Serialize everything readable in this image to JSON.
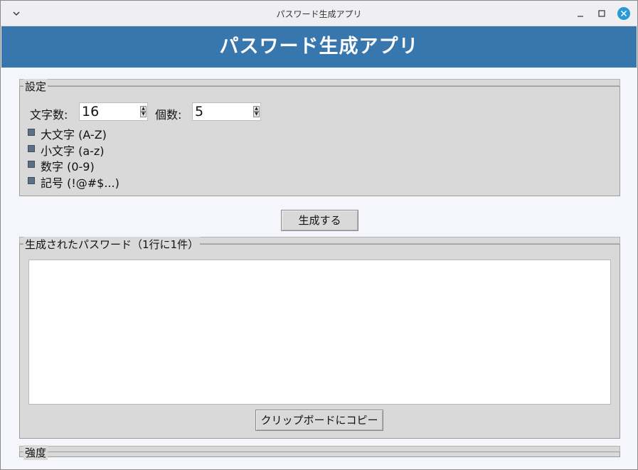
{
  "window": {
    "title": "パスワード生成アプリ",
    "icons": [
      "chevron-down-icon",
      "minimize-icon",
      "maximize-icon",
      "close-icon"
    ],
    "close_color": "#2a9ad6"
  },
  "header": {
    "title": "パスワード生成アプリ",
    "background": "#3777ad"
  },
  "settings": {
    "legend": "設定",
    "length_label": "文字数:",
    "length_value": "16",
    "count_label": "個数:",
    "count_value": "5",
    "options": [
      {
        "label": "大文字 (A-Z)",
        "checked": true
      },
      {
        "label": "小文字 (a-z)",
        "checked": true
      },
      {
        "label": "数字 (0-9)",
        "checked": true
      },
      {
        "label": "記号 (!@#$...)",
        "checked": true
      }
    ]
  },
  "generate_button": "生成する",
  "output": {
    "legend": "生成されたパスワード（1行に1件）",
    "text": "",
    "copy_button": "クリップボードにコピー"
  },
  "strength": {
    "legend": "強度"
  }
}
